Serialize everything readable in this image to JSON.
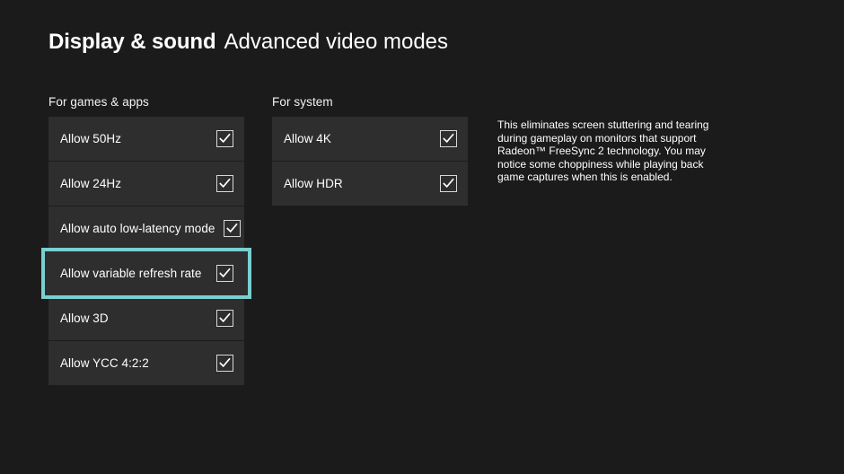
{
  "header": {
    "title_primary": "Display & sound",
    "title_secondary": "Advanced video modes"
  },
  "colors": {
    "page_background": "#1b1b1b",
    "row_background": "#2e2e2e",
    "focus_outline": "#79d0d0",
    "text": "#ffffff",
    "checkbox_border": "#d8d8d8"
  },
  "columns": {
    "games_apps": {
      "header": "For games & apps",
      "items": [
        {
          "label": "Allow 50Hz",
          "checked": true,
          "focused": false
        },
        {
          "label": "Allow 24Hz",
          "checked": true,
          "focused": false
        },
        {
          "label": "Allow auto low-latency mode",
          "checked": true,
          "focused": false
        },
        {
          "label": "Allow variable refresh rate",
          "checked": true,
          "focused": true
        },
        {
          "label": "Allow 3D",
          "checked": true,
          "focused": false
        },
        {
          "label": "Allow YCC 4:2:2",
          "checked": true,
          "focused": false
        }
      ]
    },
    "system": {
      "header": "For system",
      "items": [
        {
          "label": "Allow 4K",
          "checked": true,
          "focused": false
        },
        {
          "label": "Allow HDR",
          "checked": true,
          "focused": false
        }
      ]
    }
  },
  "description": {
    "text": "This eliminates screen stuttering and tearing during gameplay on monitors that support Radeon™ FreeSync 2 technology. You may notice some choppiness while playing back game captures when this is enabled."
  },
  "icons": {
    "checkmark": "check-icon"
  }
}
